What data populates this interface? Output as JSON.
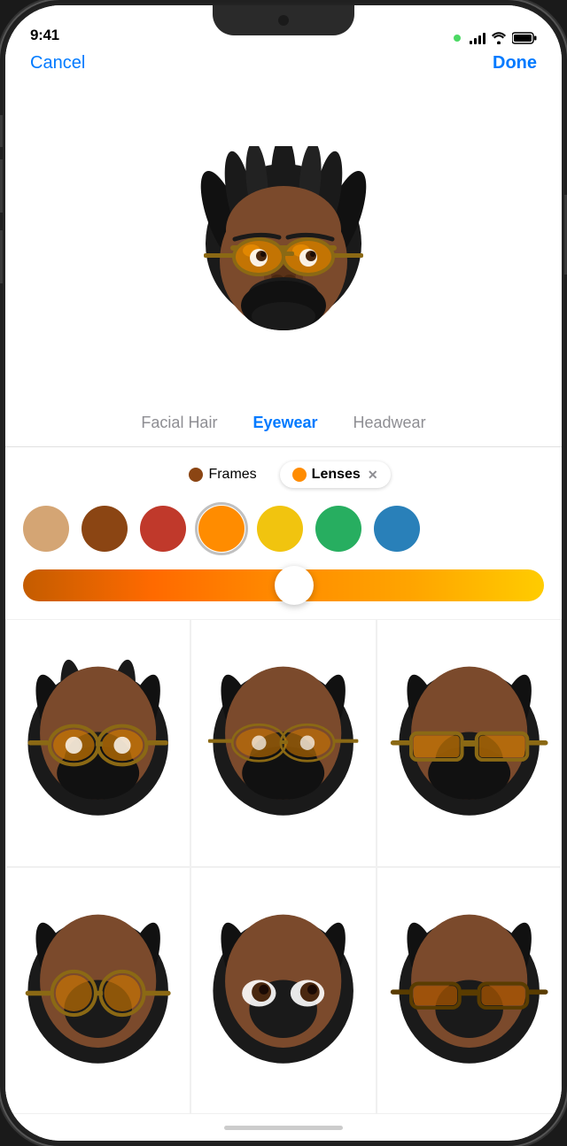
{
  "statusBar": {
    "time": "9:41",
    "greenDot": "#4CD964"
  },
  "nav": {
    "cancelLabel": "Cancel",
    "doneLabel": "Done"
  },
  "tabs": [
    {
      "id": "facial-hair",
      "label": "Facial Hair",
      "active": false
    },
    {
      "id": "eyewear",
      "label": "Eyewear",
      "active": true
    },
    {
      "id": "headwear",
      "label": "Headwear",
      "active": false
    }
  ],
  "filters": [
    {
      "id": "frames",
      "label": "Frames",
      "active": false,
      "color": "#8B4513"
    },
    {
      "id": "lenses",
      "label": "Lenses",
      "active": true,
      "color": "#FF8C00"
    }
  ],
  "swatches": [
    {
      "color": "#D4A574",
      "selected": false
    },
    {
      "color": "#8B4513",
      "selected": false
    },
    {
      "color": "#C0392B",
      "selected": false
    },
    {
      "color": "#FF8C00",
      "selected": true
    },
    {
      "color": "#F1C40F",
      "selected": false
    },
    {
      "color": "#27AE60",
      "selected": false
    },
    {
      "color": "#2980B9",
      "selected": false
    }
  ],
  "slider": {
    "thumbPosition": 52,
    "gradientStart": "#c45c00",
    "gradientEnd": "#ffcc00"
  },
  "memojis": [
    {
      "id": 1,
      "glasses": "round"
    },
    {
      "id": 2,
      "glasses": "round-thin"
    },
    {
      "id": 3,
      "glasses": "wide"
    },
    {
      "id": 4,
      "glasses": "round-small"
    },
    {
      "id": 5,
      "glasses": "none"
    },
    {
      "id": 6,
      "glasses": "wide-dark"
    }
  ]
}
